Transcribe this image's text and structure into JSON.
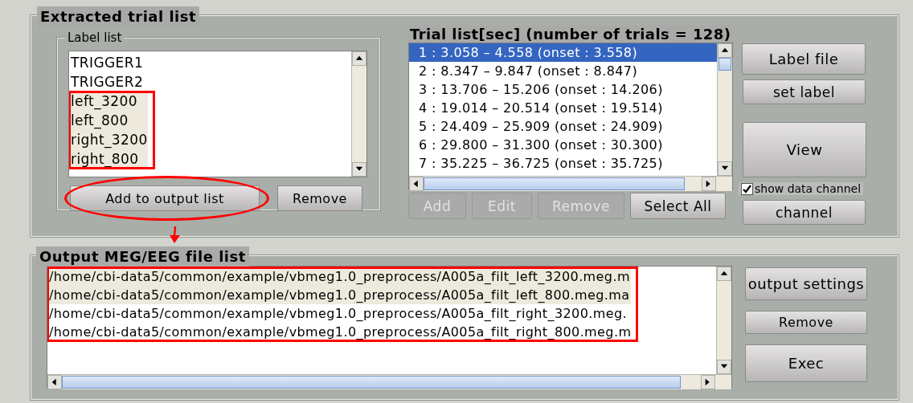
{
  "extracted": {
    "title": "Extracted trial list",
    "label_list": {
      "title": "Label list",
      "items": [
        {
          "text": "TRIGGER1",
          "selected": false,
          "marked": false
        },
        {
          "text": "TRIGGER2",
          "selected": false,
          "marked": false
        },
        {
          "text": "left_3200",
          "selected": true,
          "marked": true
        },
        {
          "text": "left_800",
          "selected": true,
          "marked": true
        },
        {
          "text": "right_3200",
          "selected": true,
          "marked": true
        },
        {
          "text": "right_800",
          "selected": true,
          "marked": true
        }
      ],
      "buttons": [
        {
          "label": "Add to output list",
          "marked": true
        },
        {
          "label": "Remove",
          "marked": false
        }
      ]
    },
    "trial_list": {
      "title": "Trial list[sec] (number of trials = 128)",
      "items": [
        {
          "text": "1 : 3.058 – 4.558 (onset : 3.558)",
          "selected": true
        },
        {
          "text": "2 : 8.347 – 9.847 (onset : 8.847)",
          "selected": false
        },
        {
          "text": "3 : 13.706 – 15.206 (onset : 14.206)",
          "selected": false
        },
        {
          "text": "4 : 19.014 – 20.514 (onset : 19.514)",
          "selected": false
        },
        {
          "text": "5 : 24.409 – 25.909 (onset : 24.909)",
          "selected": false
        },
        {
          "text": "6 : 29.800 – 31.300 (onset : 30.300)",
          "selected": false
        },
        {
          "text": "7 : 35.225 – 36.725 (onset : 35.725)",
          "selected": false
        }
      ],
      "buttons": [
        {
          "label": "Add",
          "disabled": true
        },
        {
          "label": "Edit",
          "disabled": true
        },
        {
          "label": "Remove",
          "disabled": true
        },
        {
          "label": "Select All",
          "disabled": false
        }
      ]
    },
    "side": [
      {
        "kind": "button",
        "label": "Label file"
      },
      {
        "kind": "button",
        "label": "set label"
      },
      {
        "kind": "tall",
        "label": "View"
      },
      {
        "kind": "checkbox",
        "label": "show data channel",
        "checked": true
      },
      {
        "kind": "button",
        "label": "channel"
      }
    ]
  },
  "output": {
    "title": "Output MEG/EEG file list",
    "items": [
      {
        "text": "/home/cbi-data5/common/example/vbmeg1.0_preprocess/A005a_filt_left_3200.meg.m",
        "selected": true,
        "marked": true
      },
      {
        "text": "/home/cbi-data5/common/example/vbmeg1.0_preprocess/A005a_filt_left_800.meg.ma",
        "selected": true,
        "marked": true
      },
      {
        "text": "/home/cbi-data5/common/example/vbmeg1.0_preprocess/A005a_filt_right_3200.meg.",
        "selected": false,
        "marked": true
      },
      {
        "text": "/home/cbi-data5/common/example/vbmeg1.0_preprocess/A005a_filt_right_800.meg.m",
        "selected": false,
        "marked": true
      }
    ],
    "buttons": [
      {
        "label": "output settings"
      },
      {
        "label": "Remove"
      },
      {
        "label": "Exec"
      }
    ]
  }
}
